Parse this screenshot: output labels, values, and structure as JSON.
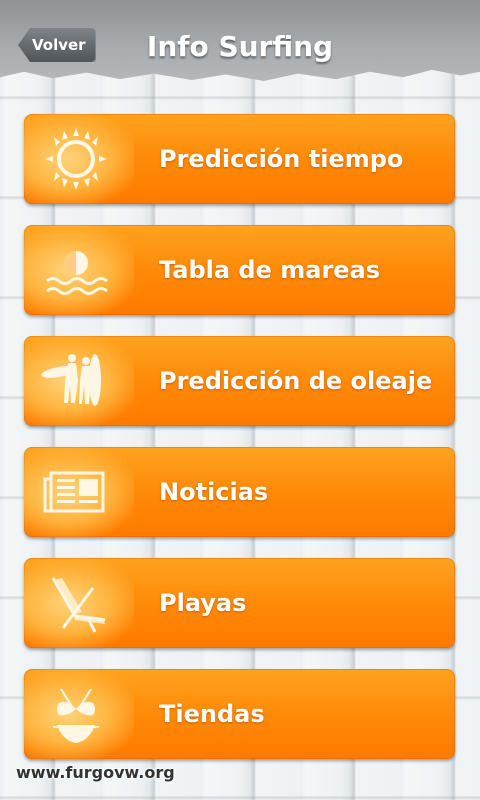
{
  "header": {
    "back_label": "Volver",
    "title": "Info Surfing"
  },
  "menu": [
    {
      "label": "Predicción tiempo",
      "icon": "sun-icon"
    },
    {
      "label": "Tabla de mareas",
      "icon": "tide-icon"
    },
    {
      "label": "Predicción de oleaje",
      "icon": "surfers-icon"
    },
    {
      "label": "Noticias",
      "icon": "newspaper-icon"
    },
    {
      "label": "Playas",
      "icon": "beach-chair-icon"
    },
    {
      "label": "Tiendas",
      "icon": "bikini-icon"
    }
  ],
  "watermark": "www.furgovw.org",
  "colors": {
    "accent": "#ff8a08",
    "header": "#a9adb0"
  }
}
